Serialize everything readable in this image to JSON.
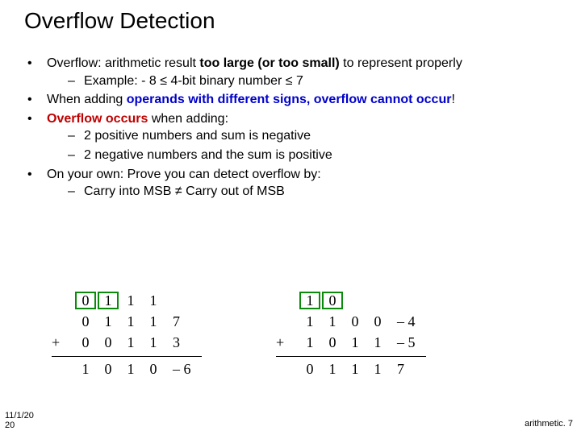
{
  "title": "Overflow Detection",
  "bullets": {
    "b1a": "Overflow: arithmetic result ",
    "b1b": "too large (or too small)",
    "b1c": " to represent properly",
    "b1s1": "Example: - 8 ≤ 4-bit binary number ≤ 7",
    "b2a": "When adding ",
    "b2b": "operands with different signs, overflow cannot occur",
    "b2c": "!",
    "b3a": "Overflow occurs",
    "b3b": " when adding:",
    "b3s1": "2 positive numbers and  sum is negative",
    "b3s2": "2 negative numbers and the sum is positive",
    "b4": "On your own: Prove you can detect overflow by:",
    "b4s1": "Carry into MSB ≠ Carry out of MSB"
  },
  "tables": {
    "left": {
      "carry": [
        "0",
        "1",
        "1",
        "1"
      ],
      "row1": [
        "0",
        "1",
        "1",
        "1"
      ],
      "row2": [
        "0",
        "0",
        "1",
        "1"
      ],
      "res": [
        "1",
        "0",
        "1",
        "0"
      ],
      "v1": "7",
      "v2": "3",
      "vr": "– 6",
      "plus": "+"
    },
    "right": {
      "carry": [
        "1",
        "0",
        "",
        ""
      ],
      "row1": [
        "1",
        "1",
        "0",
        "0"
      ],
      "row2": [
        "1",
        "0",
        "1",
        "1"
      ],
      "res": [
        "0",
        "1",
        "1",
        "1"
      ],
      "v1": "– 4",
      "v2": "– 5",
      "vr": "7",
      "plus": "+"
    }
  },
  "footer": {
    "date1": "11/1/20",
    "date2": "20",
    "page": "arithmetic. 7"
  }
}
